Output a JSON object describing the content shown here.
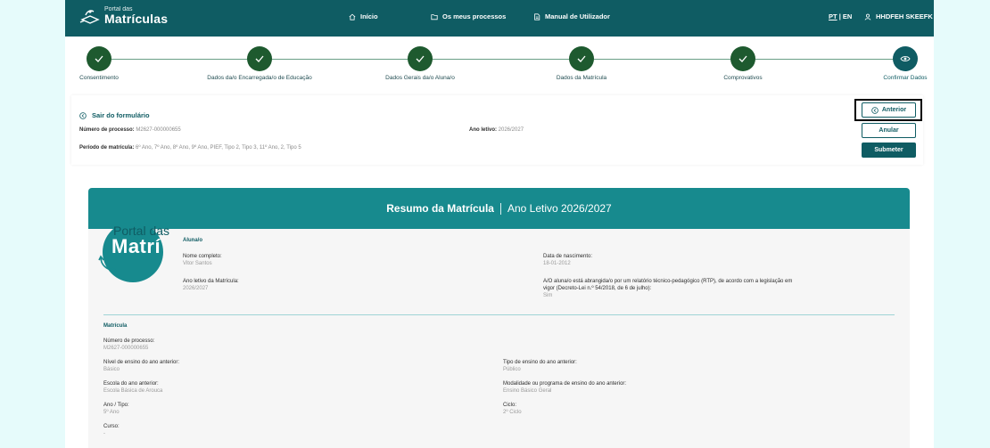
{
  "header": {
    "logo_small": "Portal das",
    "logo_big": "Matrículas",
    "nav": [
      {
        "label": "Início",
        "icon": "home-icon"
      },
      {
        "label": "Os meus processos",
        "icon": "folder-icon"
      },
      {
        "label": "Manual de Utilizador",
        "icon": "document-icon"
      }
    ],
    "lang_pt": "PT",
    "lang_sep": "|",
    "lang_en": "EN",
    "user": "HHDFEH SKEEFK"
  },
  "stepper": {
    "steps": [
      {
        "label": "Consentimento",
        "state": "done"
      },
      {
        "label": "Dados da/o Encarregada/o de Educação",
        "state": "done"
      },
      {
        "label": "Dados Gerais da/o Aluna/o",
        "state": "done"
      },
      {
        "label": "Dados da Matrícula",
        "state": "done"
      },
      {
        "label": "Comprovativos",
        "state": "done"
      },
      {
        "label": "Confirmar Dados",
        "state": "current"
      }
    ]
  },
  "info": {
    "exit_label": "Sair do formulário",
    "process_label": "Número de processo:",
    "process_value": "M2627-000000655",
    "year_label": "Ano letivo:",
    "year_value": "2026/2027",
    "period_label": "Período de matrícula:",
    "period_value": "6º Ano, 7º Ano, 8º Ano, 9º Ano, PIEF, Tipo 2, Tipo 3, 11º Ano, 2, Tipo 5"
  },
  "buttons": {
    "anterior": "Anterior",
    "anular": "Anular",
    "submeter": "Submeter"
  },
  "summary": {
    "title": "Resumo da Matrícula",
    "subtitle": "Ano Letivo 2026/2027",
    "watermark_1": "Portal das",
    "watermark_2": "Matrí",
    "aluno_section": "Aluna/o",
    "nome_label": "Nome completo:",
    "nome_value": "Vitor Santos",
    "nasc_label": "Data de nascimento:",
    "nasc_value": "18-01-2012",
    "ano_label": "Ano letivo da Matrícula:",
    "ano_value": "2026/2027",
    "rtp_label_1": "A/O aluna/o está abrangida/o por um relatório técnico-pedagógico (RTP), de acordo com a legislação em",
    "rtp_label_2": "vigor (Decreto-Lei n.º 54/2018, de 6 de julho):",
    "rtp_value": "Sim",
    "matricula_section": "Matrícula",
    "np_label": "Número de processo:",
    "np_value": "M2627-000000655",
    "nivel_label": "Nível de ensino do ano anterior:",
    "nivel_value": "Básico",
    "tipo_label": "Tipo de ensino do ano anterior:",
    "tipo_value": "Público",
    "escola_label": "Escola do ano anterior:",
    "escola_value": "Escola Básica de Arouca",
    "modalidade_label": "Modalidade ou programa de ensino do ano anterior:",
    "modalidade_value": "Ensino Básico Geral",
    "anotipo_label": "Ano / Tipo:",
    "anotipo_value": "5º Ano",
    "ciclo_label": "Ciclo:",
    "ciclo_value": "2º Ciclo",
    "curso_label": "Curso:",
    "curso_value": "-"
  },
  "colors": {
    "header_bg": "#0f5c63",
    "step_done": "#1e5a2f",
    "step_current": "#0f5c63",
    "summary_head": "#178a8e",
    "page_bg": "#e6fbfb"
  }
}
